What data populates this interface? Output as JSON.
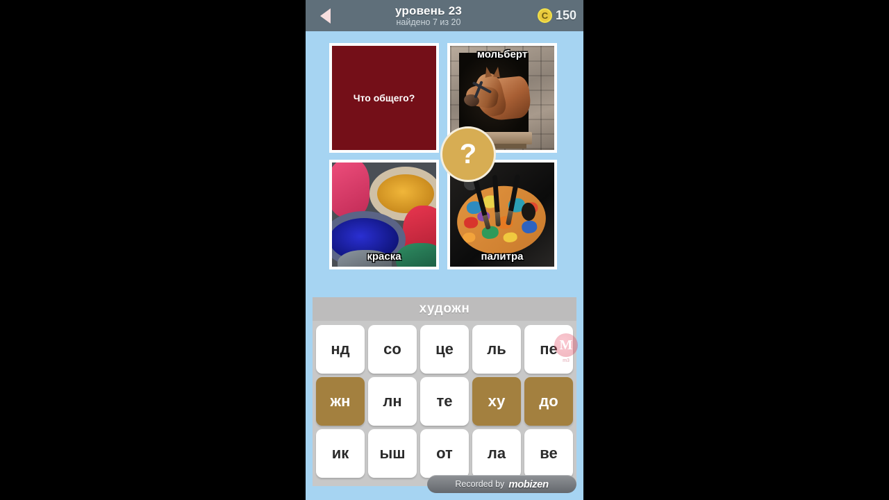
{
  "header": {
    "back_icon": "triangle-left-icon",
    "level_title": "уровень 23",
    "progress": "найдено 7 из 20",
    "coin_icon": "coin-icon",
    "coin_glyph": "C",
    "coin_count": "150"
  },
  "grid": {
    "center_badge": "?",
    "cells": [
      {
        "name": "prompt",
        "caption": "",
        "prompt_text": "Что общего?"
      },
      {
        "name": "easel",
        "caption": "мольберт",
        "caption_position": "top"
      },
      {
        "name": "paint",
        "caption": "краска",
        "caption_position": "bottom"
      },
      {
        "name": "palette",
        "caption": "палитра",
        "caption_position": "bottom"
      }
    ]
  },
  "answer": {
    "text": "художн"
  },
  "tiles": {
    "rows": [
      [
        {
          "label": "нд",
          "selected": false
        },
        {
          "label": "со",
          "selected": false
        },
        {
          "label": "це",
          "selected": false
        },
        {
          "label": "ль",
          "selected": false
        },
        {
          "label": "пе",
          "selected": false
        }
      ],
      [
        {
          "label": "жн",
          "selected": true
        },
        {
          "label": "лн",
          "selected": false
        },
        {
          "label": "те",
          "selected": false
        },
        {
          "label": "ху",
          "selected": true
        },
        {
          "label": "до",
          "selected": true
        }
      ],
      [
        {
          "label": "ик",
          "selected": false
        },
        {
          "label": "ыш",
          "selected": false
        },
        {
          "label": "от",
          "selected": false
        },
        {
          "label": "ла",
          "selected": false
        },
        {
          "label": "ве",
          "selected": false
        }
      ]
    ]
  },
  "watermark": {
    "recorded_label": "Recorded by",
    "logo_text": "mobizen",
    "corner_mark": "M",
    "corner_text": "m3"
  },
  "colors": {
    "header_bg": "#5f6f7a",
    "screen_bg": "#a6d4f2",
    "tile_selected": "#a3803f",
    "badge": "#d7ad53",
    "answer_bar": "#bdbcbc",
    "prompt_panel": "#740f18"
  }
}
